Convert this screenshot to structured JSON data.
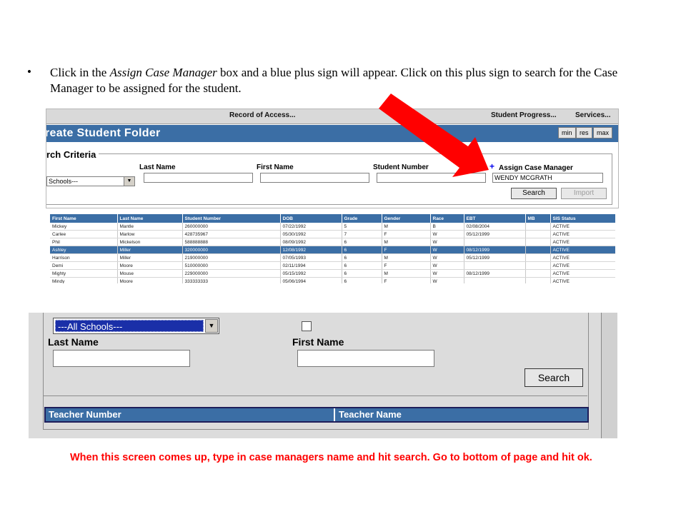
{
  "instruction": {
    "bullet": "•",
    "text_before": "Click in the ",
    "emphasis": "Assign Case Manager",
    "text_after": " box and a blue plus sign will appear. Click on this plus sign to search for the Case Manager to be assigned for the student."
  },
  "folder_window": {
    "menu": [
      "Record of Access...",
      "Student Progress...",
      "Services..."
    ],
    "title": "reate Student Folder",
    "window_buttons": [
      "min",
      "res",
      "max"
    ],
    "section_legend": "rch Criteria",
    "labels": {
      "last_name": "Last Name",
      "first_name": "First Name",
      "student_number": "Student Number",
      "assign_case_manager": "Assign Case Manager"
    },
    "plus_icon": "+",
    "school_select_value": "Schools---",
    "assign_case_manager_value": "WENDY MCGRATH",
    "buttons": {
      "search": "Search",
      "import": "Import"
    }
  },
  "results_table": {
    "headers": [
      "First Name",
      "Last Name",
      "Student Number",
      "DOB",
      "Grade",
      "Gender",
      "Race",
      "EBT",
      "MB",
      "SIS Status"
    ],
    "rows": [
      [
        "Mickey",
        "Mantle",
        "260000000",
        "07/22/1992",
        "5",
        "M",
        "B",
        "02/08/2004",
        "",
        "ACTIVE"
      ],
      [
        "Carlee",
        "Marlow",
        "428735967",
        "05/30/1992",
        "7",
        "F",
        "W",
        "05/12/1999",
        "",
        "ACTIVE"
      ],
      [
        "Phil",
        "Mickelson",
        "588888888",
        "08/09/1992",
        "6",
        "M",
        "W",
        "",
        "",
        "ACTIVE"
      ],
      [
        "Ashley",
        "Miller",
        "320000000",
        "12/08/1992",
        "6",
        "F",
        "W",
        "08/12/1999",
        "",
        "ACTIVE"
      ],
      [
        "Harrison",
        "Miller",
        "219000000",
        "07/05/1993",
        "6",
        "M",
        "W",
        "05/12/1999",
        "",
        "ACTIVE"
      ],
      [
        "Demi",
        "Moore",
        "510000000",
        "02/11/1994",
        "6",
        "F",
        "W",
        "",
        "",
        "ACTIVE"
      ],
      [
        "Mighty",
        "Mouse",
        "229000000",
        "05/15/1992",
        "6",
        "M",
        "W",
        "08/12/1999",
        "",
        "ACTIVE"
      ],
      [
        "Mindy",
        "Moore",
        "333333333",
        "05/06/1994",
        "6",
        "F",
        "W",
        "",
        "",
        "ACTIVE"
      ]
    ],
    "selected_row": 3
  },
  "teacher_search": {
    "school_select_value": "---All Schools---",
    "labels": {
      "last_name": "Last Name",
      "first_name": "First Name"
    },
    "search_button": "Search",
    "table_headers": [
      "Teacher Number",
      "Teacher Name"
    ]
  },
  "note": "When this screen comes up, type in case managers name and hit search. Go to bottom of page and hit ok.",
  "colors": {
    "title_blue": "#3b6ea5",
    "arrow_red": "#ff0000",
    "note_red": "#ff0000",
    "plus_blue": "#0000ee"
  }
}
